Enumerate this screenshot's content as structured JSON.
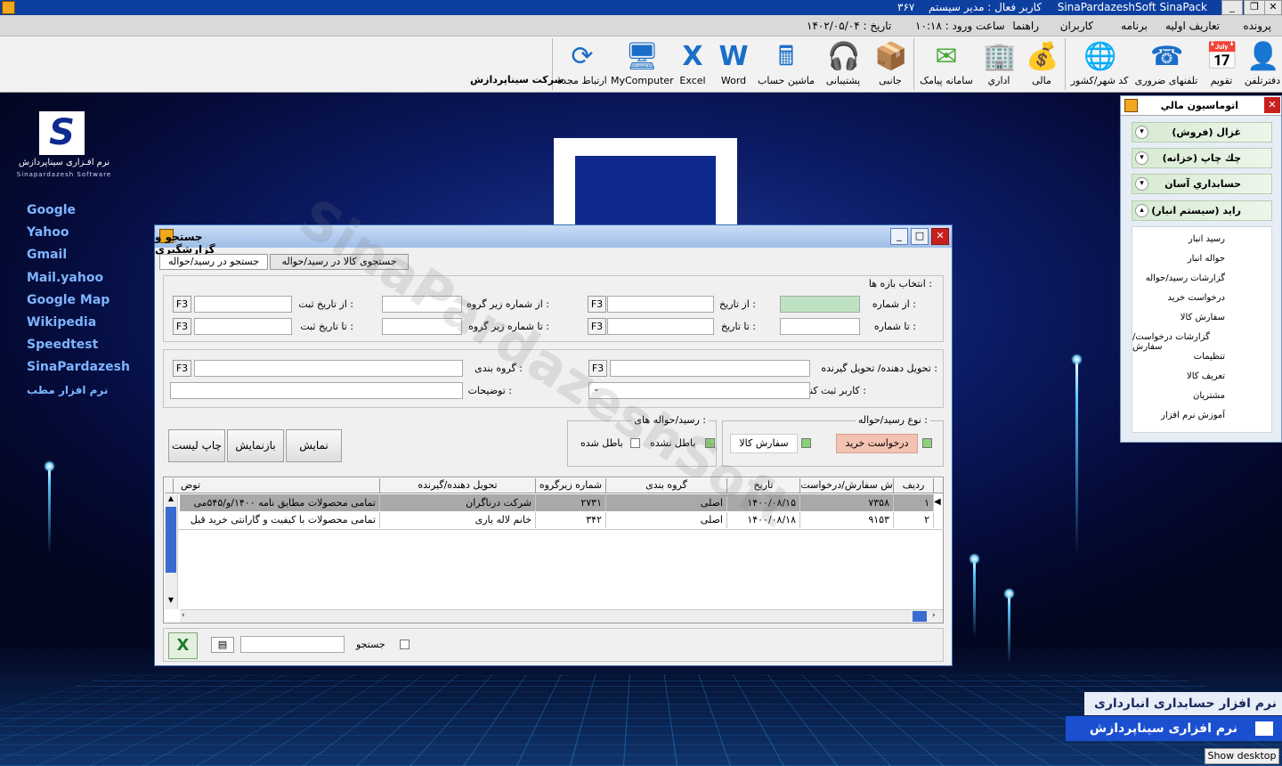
{
  "window": {
    "app_title": "SinaPardazeshSoft SinaPack",
    "user": "کاربر فعال : مدیر سیستم",
    "number": "۳۶۷",
    "minimize": "_",
    "restore": "❐",
    "close": "✕"
  },
  "menu": {
    "items": [
      "پرونده",
      "تعاریف اولیه",
      "برنامه",
      "کاربران",
      "راهنما"
    ],
    "login_time": "ساعت ورود : ۱۰:۱۸",
    "date": "تاریخ : ۱۴۰۲/۰۵/۰۴"
  },
  "toolbar": {
    "company": "شرکت سیناپردازش",
    "tools": [
      {
        "label": "دفترتلفن",
        "icon": "phonebook-icon",
        "glyph": "👤"
      },
      {
        "label": "تقویم",
        "icon": "calendar-icon",
        "glyph": "📅"
      },
      {
        "label": "تلفنهای ضروری",
        "icon": "emergency-phone-icon",
        "glyph": "☎"
      },
      {
        "label": "کد شهر/کشور",
        "icon": "globe-icon",
        "glyph": "🌐"
      },
      {
        "label": "مالی",
        "icon": "finance-icon",
        "glyph": "💰"
      },
      {
        "label": "اداري",
        "icon": "office-icon",
        "glyph": "🏢"
      },
      {
        "label": "سامانه پیامک",
        "icon": "sms-icon",
        "glyph": "✉"
      },
      {
        "label": "جانبی",
        "icon": "box-icon",
        "glyph": "📦"
      },
      {
        "label": "پشتیبانی",
        "icon": "support-icon",
        "glyph": "🎧"
      },
      {
        "label": "ماشین حساب",
        "icon": "calculator-icon",
        "glyph": "🖩"
      },
      {
        "label": "Word",
        "icon": "word-icon",
        "glyph": "W"
      },
      {
        "label": "Excel",
        "icon": "excel-icon",
        "glyph": "X"
      },
      {
        "label": "MyComputer",
        "icon": "computer-icon",
        "glyph": "🖥"
      },
      {
        "label": "ارتباط مجدد",
        "icon": "reconnect-icon",
        "glyph": "⟳"
      }
    ]
  },
  "desktop": {
    "logo_text": "نرم افـزاری سیناپردازش",
    "logo_sub": "Sinapardazesh Software",
    "links": [
      "Google",
      "Yahoo",
      "Gmail",
      "Mail.yahoo",
      "Google Map",
      "Wikipedia",
      "Speedtest",
      "SinaPardazesh",
      "نرم افزار مطب"
    ],
    "promo1": "نرم افزار حسابداری انبارداری",
    "promo2": "نرم افزاری سیناپردازش",
    "show_desktop": "Show desktop"
  },
  "right_panel": {
    "title": "اتوماسیون مالي",
    "sections": [
      "غزال (فروش)",
      "چك چاپ (خزانه)",
      "حسابداري آسان",
      "رايد (سيستم انبار)"
    ],
    "sub_items": [
      "رسید انبار",
      "حواله انبار",
      "گزارشات رسید/حواله",
      "درخواست خرید",
      "سفارش کالا",
      "گزارشات درخواست/سفارش",
      "تنظیمات",
      "تعریف کالا",
      "مشتریان",
      "آموزش نرم افزار"
    ]
  },
  "dialog": {
    "title": "جستجو و گزارشگیری",
    "tabs": [
      "جستجو در رسید/حواله",
      "جستجوی کالا در رسید/حواله"
    ],
    "range_title": "انتخاب بازه ها :",
    "labels": {
      "from_number": "از شماره :",
      "to_number": "تا شماره :",
      "from_date": "از تاریخ :",
      "to_date": "تا تاریخ :",
      "from_subgroup": "از شماره زیر گروه :",
      "to_subgroup": "تا شماره زیر گروه :",
      "from_reg_date": "از تاریخ ثبت :",
      "to_reg_date": "تا تاریخ ثبت :",
      "deliverer": "تحویل دهنده/ تحویل گیرنده :",
      "category": "گروه بندی :",
      "registrar": "کاربر ثبت کننده :",
      "description": "توضیحات :"
    },
    "f3": "F3",
    "type_group": "نوع رسید/حواله :",
    "types": [
      "درخواست خرید",
      "سفارش کالا"
    ],
    "status_group": "رسید/حواله های :",
    "statuses": [
      "باطل نشده",
      "باطل شده"
    ],
    "buttons": {
      "show": "نمایش",
      "reshow": "بازنمایش",
      "print": "چاپ لیست"
    },
    "grid": {
      "columns": [
        "ردیف",
        "ش سفارش/درخواست",
        "تاریخ",
        "گروه بندی",
        "شماره زیرگروه",
        "تحویل دهنده/گیرنده",
        "توض"
      ],
      "rows": [
        [
          "۱",
          "۷۳۵۸",
          "۱۴۰۰/۰۸/۱۵",
          "اصلی",
          "۲۷۳۱",
          "شرکت درناگران",
          "تمامی محصولات مطابق نامه ۱۴۰۰/و/۵۴۵می"
        ],
        [
          "۲",
          "۹۱۵۳",
          "۱۴۰۰/۰۸/۱۸",
          "اصلی",
          "۳۴۲",
          "خانم لاله یاری",
          "تمامی محصولات با کیفیت و گارانتی خرید قبل"
        ]
      ]
    },
    "search_label": "جستجو",
    "watermark": "SinaPardazeshSoft"
  }
}
